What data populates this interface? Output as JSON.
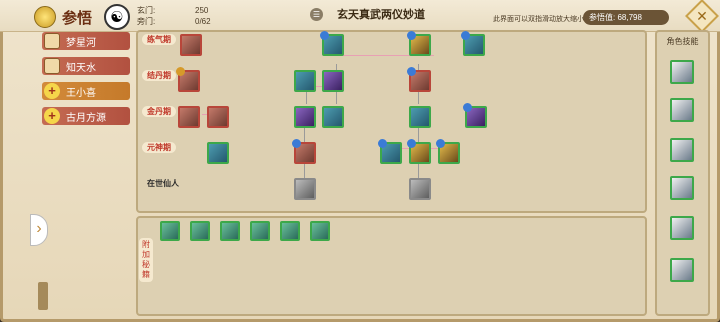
{
  "header": {
    "title": "参悟",
    "sect_label": "玄门:",
    "sect_value": "250",
    "side_label": "旁门:",
    "side_value": "0/62",
    "section_title": "玄天真武两仪妙道",
    "hint": "此界面可以双指滑动放大缩小",
    "power_label": "参悟值:",
    "power_value": "68,798"
  },
  "nav": [
    {
      "label": "梦星河",
      "type": "avatar"
    },
    {
      "label": "知天水",
      "type": "avatar"
    },
    {
      "label": "王小喜",
      "type": "plus",
      "selected": true
    },
    {
      "label": "古月方源",
      "type": "plus"
    }
  ],
  "stages": [
    "练气期",
    "结丹期",
    "金丹期",
    "元神期",
    "在世仙人"
  ],
  "bonus_label": "附加秘籍",
  "right_title": "角色技能",
  "right_skills": [
    "",
    "",
    "",
    "",
    "",
    ""
  ],
  "bottom_slots": 6,
  "colors": {
    "accent": "#c0392b",
    "frame": "#b59a6a",
    "node_border": "#3da84a"
  }
}
